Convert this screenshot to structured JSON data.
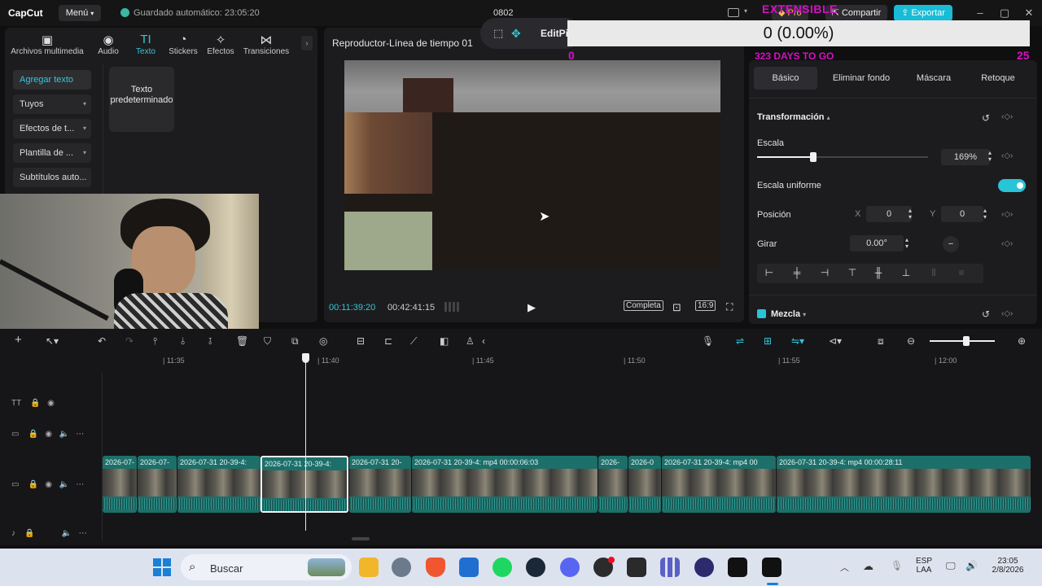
{
  "app": {
    "logo": "CapCut",
    "menu_label": "Menú",
    "autosave": "Guardado automático: 23:05:20",
    "project_name": "0802",
    "pro_label": "Pro",
    "share_label": "Compartir",
    "export_label": "Exportar"
  },
  "left_panel": {
    "tabs": [
      {
        "label": "Archivos multimedia",
        "icon": "media-icon"
      },
      {
        "label": "Audio",
        "icon": "audio-icon"
      },
      {
        "label": "Texto",
        "icon": "text-icon"
      },
      {
        "label": "Stickers",
        "icon": "sticker-icon"
      },
      {
        "label": "Efectos",
        "icon": "effects-icon"
      },
      {
        "label": "Transiciones",
        "icon": "transitions-icon"
      }
    ],
    "side_items": [
      "Agregar texto",
      "Tuyos",
      "Efectos de t...",
      "Plantilla de ...",
      "Subtítulos auto..."
    ],
    "preset_card": "Texto predeterminado"
  },
  "player": {
    "title": "Reproductor-Línea de tiempo 01",
    "current_time": "00:11:39:20",
    "total_time": "00:42:41:15",
    "quality": "Completa",
    "ratio": "16:9"
  },
  "edit_pill": {
    "label": "EditPi"
  },
  "overlay": {
    "title": "EXTENSIBLE",
    "counter": "0 (0.00%)",
    "left_num": "0",
    "days": "323 DAYS TO GO",
    "right_num": "25"
  },
  "right_panel": {
    "tabs": [
      "Básico",
      "Eliminar fondo",
      "Máscara",
      "Retoque"
    ],
    "section_transform": "Transformación",
    "scale_label": "Escala",
    "scale_value": "169%",
    "scale_fraction": 0.33,
    "uniform_label": "Escala uniforme",
    "position_label": "Posición",
    "pos_x_label": "X",
    "pos_x": "0",
    "pos_y_label": "Y",
    "pos_y": "0",
    "rotate_label": "Girar",
    "rotate_value": "0.00°",
    "blend_label": "Mezcla"
  },
  "timeline": {
    "ruler": [
      "| 11:35",
      "| 11:40",
      "| 11:45",
      "| 11:50",
      "| 11:55",
      "| 12:00"
    ],
    "clips": [
      "2026-07-",
      "2026-07-",
      "2026-07-31 20-39-4:",
      "2026-07-31 20-39-4:",
      "2026-07-31 20-",
      "2026-07-31 20-39-4: mp4   00:00:06:03",
      "2026-",
      "2026-0",
      "2026-07-31 20-39-4: mp4  00",
      "2026-07-31 20-39-4: mp4   00:00:28:11"
    ]
  },
  "taskbar": {
    "search": "Buscar",
    "lang1": "ESP",
    "lang2": "LAA",
    "time": "23:05",
    "date": "2/8/2026"
  },
  "colors": {
    "accent": "#32c7d9",
    "export": "#18bcd6",
    "clip": "#1d6f6a",
    "overlay_magenta": "#d80fc6"
  }
}
